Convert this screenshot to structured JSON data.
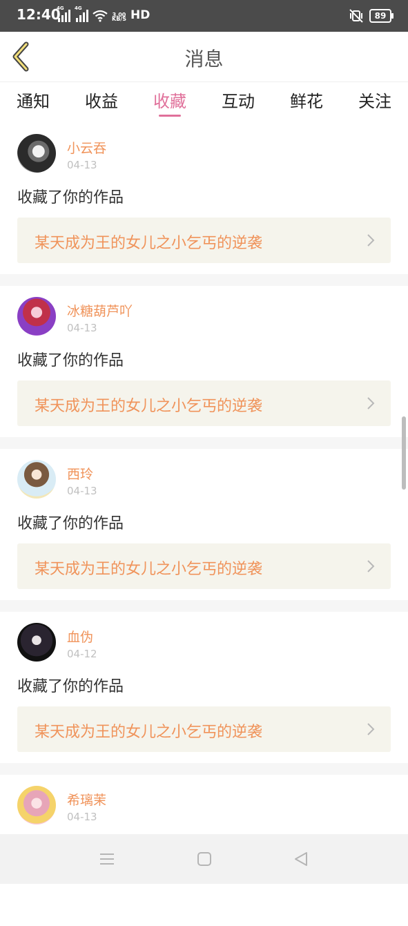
{
  "status_bar": {
    "time": "12:40",
    "net1": "4G",
    "net2": "4G",
    "speed_top": "3.00",
    "speed_bottom": "KB/S",
    "hd": "HD",
    "battery": "89"
  },
  "header": {
    "title": "消息"
  },
  "tabs": [
    {
      "label": "通知"
    },
    {
      "label": "收益"
    },
    {
      "label": "收藏"
    },
    {
      "label": "互动"
    },
    {
      "label": "鲜花"
    },
    {
      "label": "关注"
    }
  ],
  "active_tab": "收藏",
  "items": [
    {
      "name": "小云吞",
      "date": "04-13",
      "action": "收藏了你的作品",
      "work": "某天成为王的女儿之小乞丐的逆袭"
    },
    {
      "name": "冰糖葫芦吖",
      "date": "04-13",
      "action": "收藏了你的作品",
      "work": "某天成为王的女儿之小乞丐的逆袭"
    },
    {
      "name": "西玲",
      "date": "04-13",
      "action": "收藏了你的作品",
      "work": "某天成为王的女儿之小乞丐的逆袭"
    },
    {
      "name": "血伪",
      "date": "04-12",
      "action": "收藏了你的作品",
      "work": "某天成为王的女儿之小乞丐的逆袭"
    },
    {
      "name": "希璃茉",
      "date": "04-13",
      "action": "",
      "work": ""
    }
  ],
  "colors": {
    "accent": "#e0709a",
    "name": "#f0935a",
    "work_bg": "#f5f4ec"
  },
  "icons": [
    "back-arrow-icon",
    "chevron-right-icon",
    "menu-icon",
    "home-square-icon",
    "back-triangle-icon",
    "wifi-icon",
    "vibrate-mute-icon",
    "battery-icon"
  ]
}
